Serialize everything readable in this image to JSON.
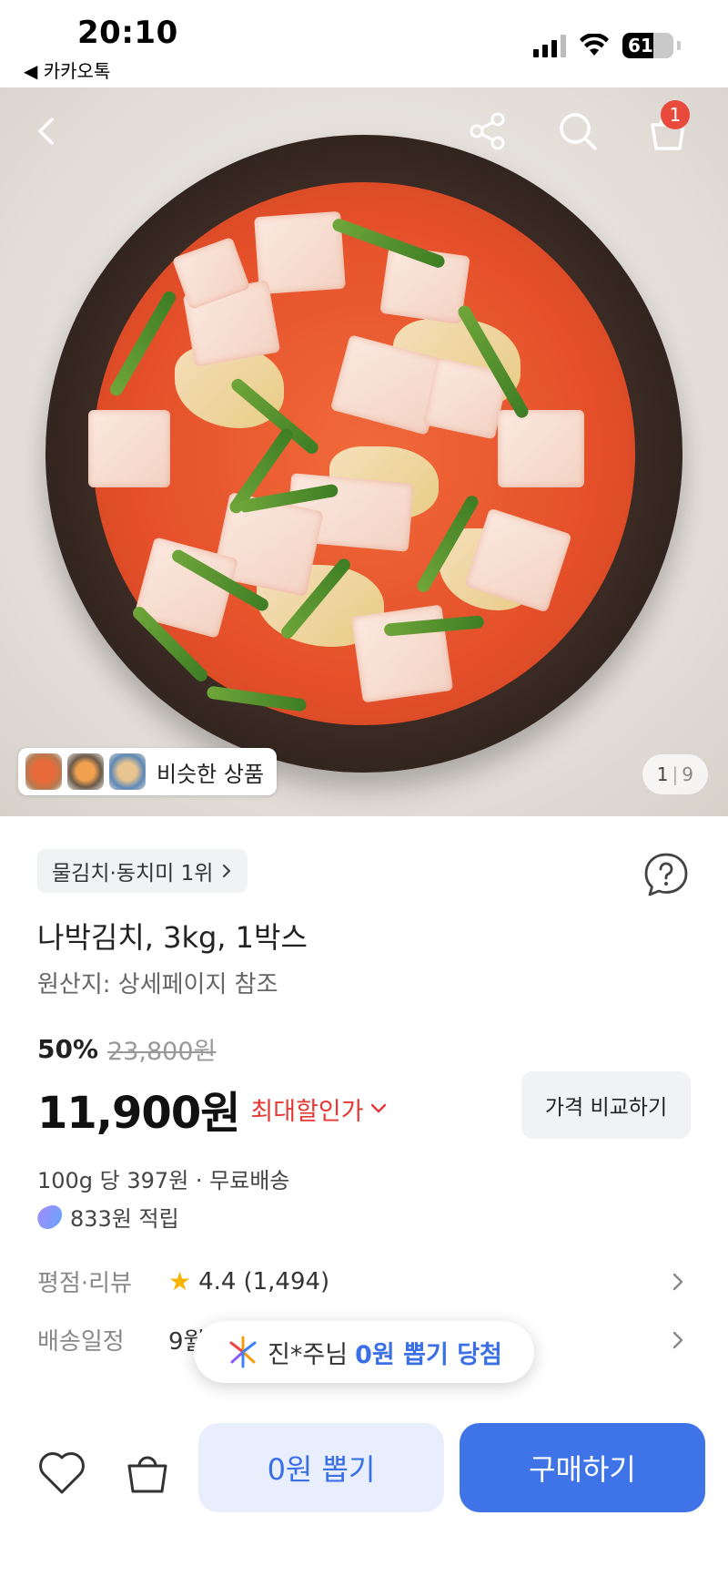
{
  "status_bar": {
    "time": "20:10",
    "back_app": "◀ 카카오톡",
    "battery_level": "61",
    "battery_fraction": 0.61
  },
  "header": {
    "cart_badge": "1"
  },
  "gallery": {
    "similar_label": "비슷한 상품",
    "page_current": "1",
    "page_total": "9"
  },
  "product": {
    "rank_label": "물김치·동치미 1위",
    "title": "나박김치, 3kg, 1박스",
    "origin": "원산지: 상세페이지 참조",
    "discount_percent": "50%",
    "original_price": "23,800원",
    "price": "11,900원",
    "max_discount_label": "최대할인가",
    "compare_button": "가격 비교하기",
    "unit_price": "100g 당 397원 · 무료배송",
    "points": "833원 적립"
  },
  "details": {
    "rating_label": "평점·리뷰",
    "rating_value": "4.4",
    "review_count": "(1,494)",
    "delivery_label": "배송일정",
    "delivery_value": "9월"
  },
  "toast": {
    "text": "진*주님",
    "highlight": "0원 뽑기 당첨"
  },
  "bottom_bar": {
    "draw_button": "0원 뽑기",
    "buy_button": "구매하기"
  },
  "colors": {
    "accent_blue": "#3f74e8",
    "sale_red": "#e53935",
    "badge_red": "#e84a3c",
    "star_yellow": "#f5b400"
  },
  "icons": [
    "back-icon",
    "share-icon",
    "search-icon",
    "cart-icon",
    "question-icon",
    "chevron-right-icon",
    "star-icon",
    "heart-icon",
    "bag-icon",
    "firework-icon",
    "points-icon"
  ]
}
